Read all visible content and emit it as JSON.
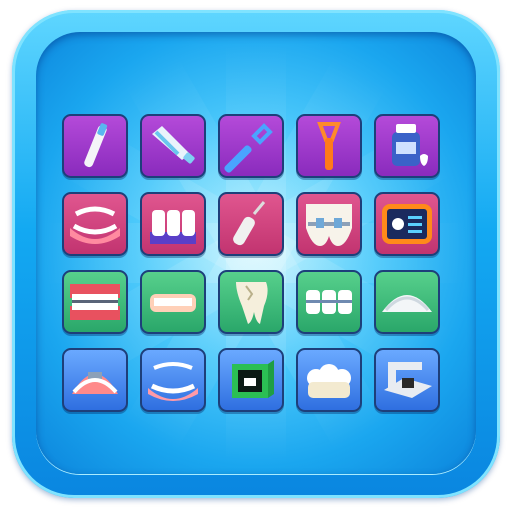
{
  "app": {
    "title": "",
    "colors": {
      "frame": "#13a9f2",
      "purple": "#8a2bbd",
      "pink": "#c23470",
      "green": "#2aa76a",
      "blue": "#2f6fe0"
    }
  },
  "grid": {
    "rows": [
      [
        "toothbrush-icon",
        "toothpaste-icon",
        "floss-pick-icon",
        "tongue-scraper-icon",
        "mouthwash-icon"
      ],
      [
        "denture-jaw-icon",
        "teeth-model-icon",
        "water-flosser-icon",
        "braces-tooth-icon",
        "dental-tablet-icon"
      ],
      [
        "braces-teeth-icon",
        "gum-guard-icon",
        "broken-tooth-icon",
        "braces-molars-icon",
        "retainer-icon"
      ],
      [
        "palate-expander-icon",
        "aligner-denture-icon",
        "dental-3d-printer-icon",
        "clean-teeth-icon",
        "dental-scanner-icon"
      ]
    ],
    "row_colors": [
      "purple",
      "pink",
      "green",
      "blue"
    ]
  }
}
